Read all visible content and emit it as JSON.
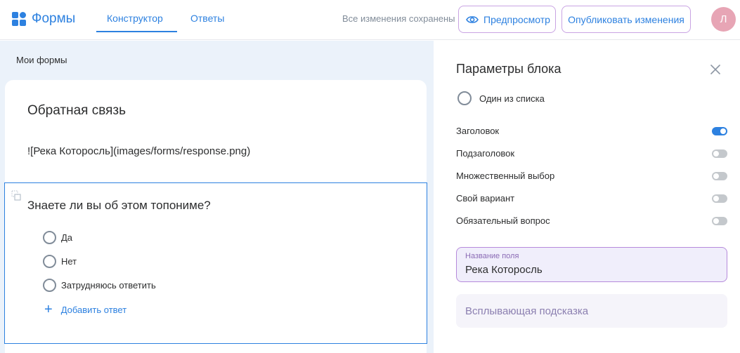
{
  "header": {
    "app_name": "Формы",
    "tabs": [
      {
        "label": "Конструктор",
        "active": true
      },
      {
        "label": "Ответы",
        "active": false
      }
    ],
    "status": "Все изменения сохранены",
    "preview_label": "Предпросмотр",
    "publish_label": "Опубликовать изменения",
    "avatar_initial": "Л",
    "accent_color": "#2d81e0"
  },
  "breadcrumb": "Мои формы",
  "form": {
    "title": "Обратная связь",
    "image_markdown": "![Река Которосль](images/forms/response.png)",
    "question": {
      "title": "Знаете ли вы об этом топониме?",
      "options": [
        "Да",
        "Нет",
        "Затрудняюсь ответить"
      ],
      "add_answer_label": "Добавить ответ"
    }
  },
  "panel": {
    "title": "Параметры блока",
    "block_type": "Один из списка",
    "settings": [
      {
        "label": "Заголовок",
        "enabled": true
      },
      {
        "label": "Подзаголовок",
        "enabled": false
      },
      {
        "label": "Множественный выбор",
        "enabled": false
      },
      {
        "label": "Свой вариант",
        "enabled": false
      },
      {
        "label": "Обязательный вопрос",
        "enabled": false
      }
    ],
    "field_name_label": "Название поля",
    "field_name_value": "Река Которосль",
    "tooltip_placeholder": "Всплывающая подсказка"
  }
}
